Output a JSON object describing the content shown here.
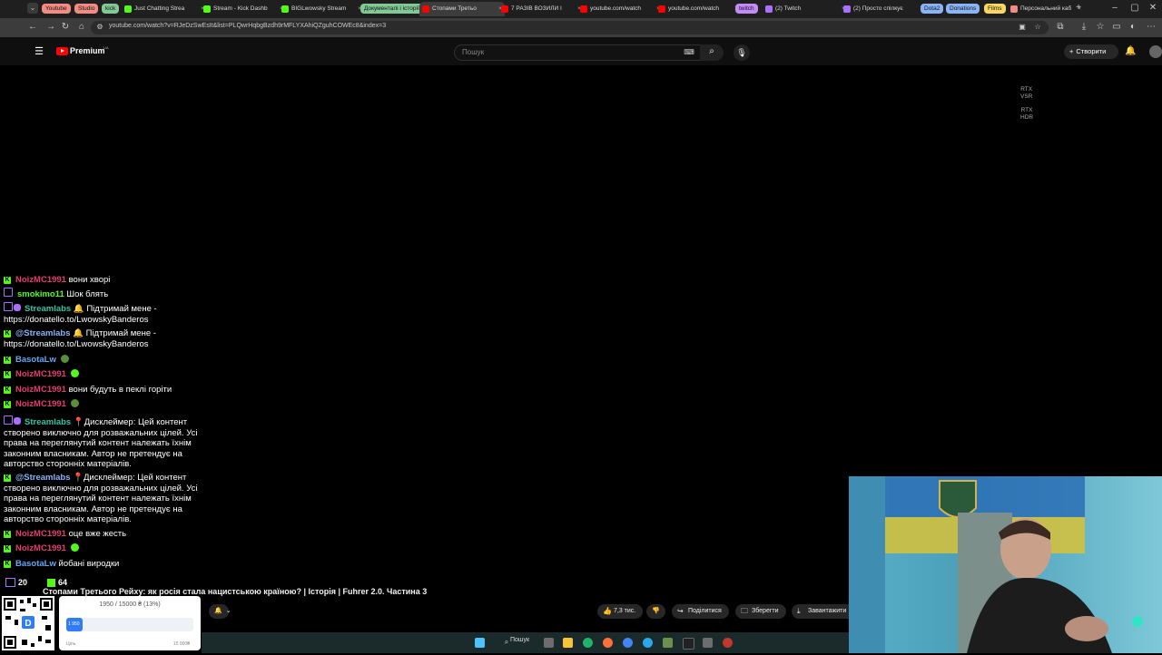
{
  "browser": {
    "tab_groups": [
      {
        "label": "Youtube",
        "color": "#f28b82"
      },
      {
        "label": "Studio",
        "color": "#f28b82"
      },
      {
        "label": "kick",
        "color": "#81c995"
      },
      {
        "label": "Документалі і історії",
        "color": "#81c995"
      },
      {
        "label": "twitch",
        "color": "#c58af9"
      },
      {
        "label": "Dota2",
        "color": "#8ab4f8"
      },
      {
        "label": "Donations",
        "color": "#8ab4f8"
      },
      {
        "label": "Films",
        "color": "#fdd663"
      }
    ],
    "tabs": [
      {
        "title": "Just Chatting Strea",
        "fav_color": "#53fc18"
      },
      {
        "title": "Stream - Kick Dashb",
        "fav_color": "#53fc18"
      },
      {
        "title": "BIGLwowsky Stream",
        "fav_color": "#53fc18"
      },
      {
        "title": "Стопами Третьо",
        "fav_color": "#ff0000"
      },
      {
        "title": "7 РАЗІВ ВОЗИЛИ І",
        "fav_color": "#ff0000"
      },
      {
        "title": "youtube.com/watch",
        "fav_color": "#ff0000"
      },
      {
        "title": "youtube.com/watch",
        "fav_color": "#ff0000"
      },
      {
        "title": "(2) Twitch",
        "fav_color": "#a970ff"
      },
      {
        "title": "(2) Просто спілкує",
        "fav_color": "#a970ff"
      },
      {
        "title": "Персональний каб",
        "fav_color": "#f28b82"
      }
    ],
    "url": "youtube.com/watch?v=RJeDzSwEsIt&list=PLQwrHqbgBzdh9rMFLYXAhiQZguhCOWEc8&index=3"
  },
  "youtube": {
    "brand": "Premium",
    "region": "UA",
    "search_placeholder": "Пошук",
    "create_label": "Створити",
    "rtx_vsr": "RTX\nVSR",
    "rtx_hdr": "RTX\nHDR",
    "video_title": "Стопами Третього Рейху: як росія стала нацистською країною? | Історія | Fuhrer 2.0. Частина 3",
    "actions": {
      "likes": "7,3 тис.",
      "share": "Поділитися",
      "save": "Зберегти",
      "download": "Завантажити"
    }
  },
  "viewers": {
    "twitch": "20",
    "kick": "64"
  },
  "chat": [
    {
      "platform": "kick",
      "user": "NoizMC1991",
      "user_color": "#e53c6e",
      "text": "вони хворі",
      "emote": null
    },
    {
      "platform": "twitch",
      "user": "smokimo11",
      "user_color": "#53fc18",
      "text": "Шок блять",
      "emote": null
    },
    {
      "platform": "streamlabs",
      "user": "Streamlabs",
      "user_color": "#31c3a2",
      "text": "🔔 Підтримай мене - https://donatello.to/LwowskyBanderos",
      "emote": null
    },
    {
      "platform": "kick",
      "user": "@Streamlabs",
      "user_color": "#8ab4f8",
      "text": "🔔 Підтримай мене - https://donatello.to/LwowskyBanderos",
      "emote": null
    },
    {
      "platform": "kick",
      "user": "BasotaLw",
      "user_color": "#5fa8f0",
      "text": "",
      "emote": "#5a8f3a"
    },
    {
      "platform": "kick",
      "user": "NoizMC1991",
      "user_color": "#e53c6e",
      "text": "",
      "emote": "#53fc18"
    },
    {
      "platform": "kick",
      "user": "NoizMC1991",
      "user_color": "#e53c6e",
      "text": "вони будуть в пеклі горіти",
      "emote": null
    },
    {
      "platform": "kick",
      "user": "NoizMC1991",
      "user_color": "#e53c6e",
      "text": "",
      "emote": "#5a8f3a"
    },
    {
      "platform": "streamlabs",
      "user": "Streamlabs",
      "user_color": "#31c3a2",
      "text": "📍Дисклеймер: Цей контент створено виключно для розважальних цілей. Усі права на переглянутий контент належать їхнім законним власникам. Автор не претендує на авторство сторонніх матеріалів.",
      "emote": null
    },
    {
      "platform": "kick",
      "user": "@Streamlabs",
      "user_color": "#8ab4f8",
      "text": "📍Дисклеймер: Цей контент створено виключно для розважальних цілей. Усі права на переглянутий контент належать їхнім законним власникам. Автор не претендує на авторство сторонніх матеріалів.",
      "emote": null
    },
    {
      "platform": "kick",
      "user": "NoizMC1991",
      "user_color": "#e53c6e",
      "text": "оце вже жесть",
      "emote": null
    },
    {
      "platform": "kick",
      "user": "NoizMC1991",
      "user_color": "#e53c6e",
      "text": "",
      "emote": "#53fc18"
    },
    {
      "platform": "kick",
      "user": "BasotaLw",
      "user_color": "#5fa8f0",
      "text": "йобані виродки",
      "emote": null
    }
  ],
  "donation": {
    "progress_text": "1950 / 15000 ₴ (13%)",
    "raised": "1 950",
    "fraction": 0.13,
    "goal_label": "Ціль",
    "goal_total": "15 000₴"
  },
  "taskbar": {
    "search_label": "Пошук"
  }
}
